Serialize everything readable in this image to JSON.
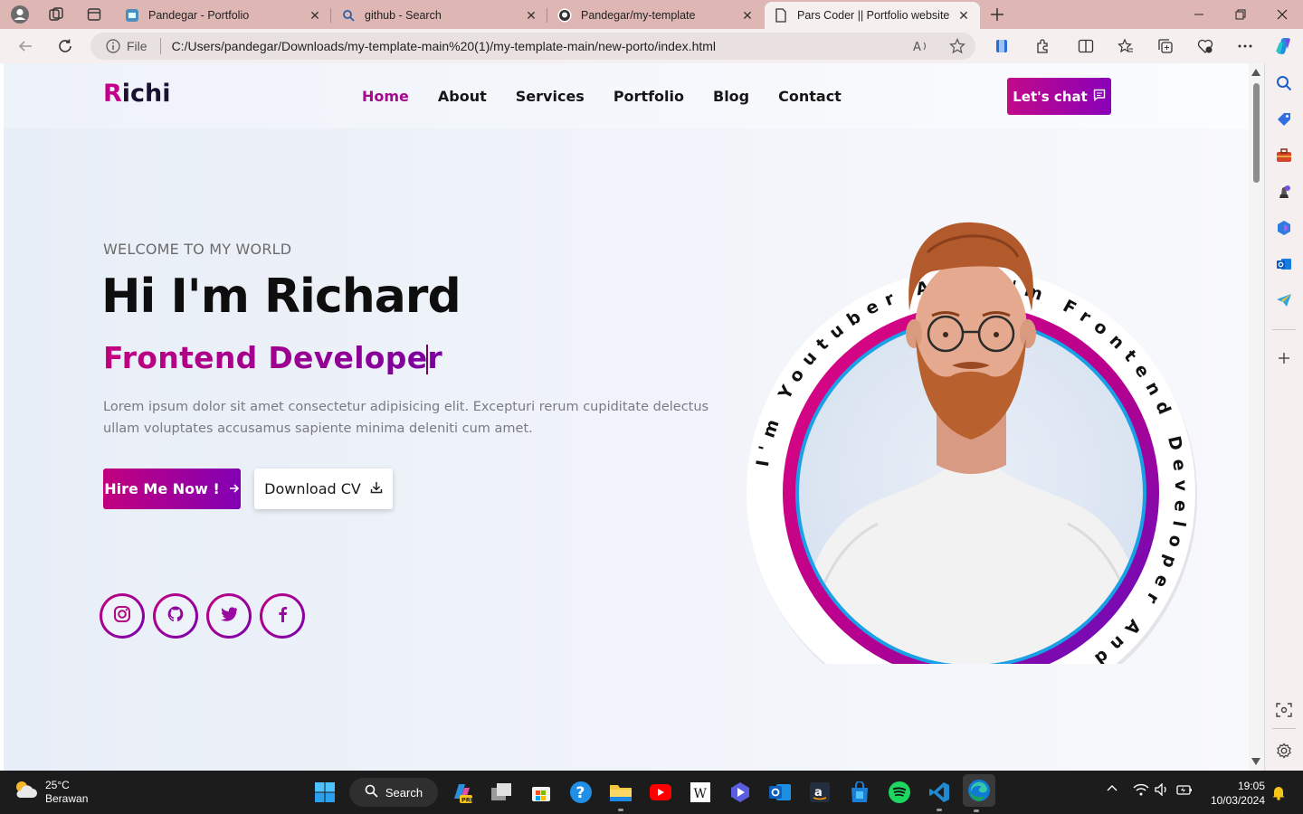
{
  "browser": {
    "tabs": [
      {
        "title": "Pandegar - Portfolio",
        "active": false
      },
      {
        "title": "github - Search",
        "active": false
      },
      {
        "title": "Pandegar/my-template",
        "active": false
      },
      {
        "title": "Pars Coder || Portfolio website",
        "active": true
      }
    ],
    "address": {
      "scheme_label": "File",
      "url": "C:/Users/pandegar/Downloads/my-template-main%20(1)/my-template-main/new-porto/index.html"
    }
  },
  "site": {
    "logo": {
      "first_letter": "R",
      "rest": "ichi"
    },
    "nav": [
      "Home",
      "About",
      "Services",
      "Portfolio",
      "Blog",
      "Contact"
    ],
    "active_nav": "Home",
    "chat_button": "Let's chat",
    "hero": {
      "kicker": "WELCOME TO MY WORLD",
      "title": "Hi I'm Richard",
      "role": "Frontend Developer",
      "description": "Lorem ipsum dolor sit amet consectetur adipisicing elit. Excepturi rerum cupiditate delectus ullam voluptates accusamus sapiente minima deleniti cum amet.",
      "hire_button": "Hire Me Now !",
      "cv_button": "Download CV"
    },
    "ring_text": "I'm Youtuber And I'm Frontend Developer And I'm Designer ",
    "socials": [
      "instagram",
      "github",
      "twitter",
      "facebook"
    ],
    "colors": {
      "accent_pink": "#c2007e",
      "accent_purple": "#7a00b0",
      "ring_blue": "#1aa0e6"
    }
  },
  "taskbar": {
    "weather": {
      "temp": "25°C",
      "condition": "Berawan"
    },
    "search_label": "Search",
    "clock": {
      "time": "19:05",
      "date": "10/03/2024"
    }
  }
}
